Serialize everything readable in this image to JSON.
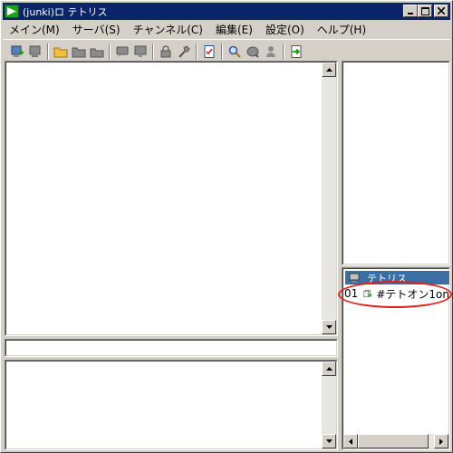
{
  "window": {
    "title": "(junki)ロ テトリス"
  },
  "menu": [
    "メイン(M)",
    "サーバ(S)",
    "チャンネル(C)",
    "編集(E)",
    "設定(O)",
    "ヘルプ(H)"
  ],
  "toolbar": {
    "buttons": [
      "connect-server-icon",
      "disconnect-server-icon",
      "open-folder-icon",
      "folder-icon",
      "folder-alt-icon",
      "chat-icon",
      "chat-alt-icon",
      "lock-icon",
      "tool-icon",
      "checklist-icon",
      "search-icon",
      "find-icon",
      "user-icon",
      "exit-icon"
    ]
  },
  "channel_list": {
    "header": "テトリス",
    "rows": [
      {
        "number": "01",
        "name": "#テトオン1on",
        "icon": "channel-join-icon"
      }
    ]
  },
  "colors": {
    "titlebar": "#0a246a",
    "window_bg": "#d4d0c8",
    "highlight": "#e0201c",
    "channel_header": "#3a6ea5"
  }
}
